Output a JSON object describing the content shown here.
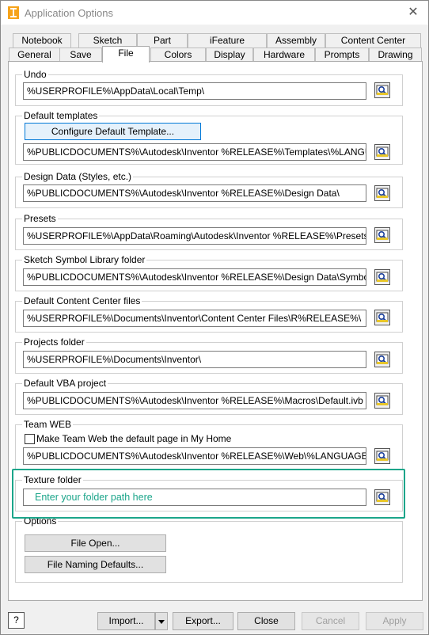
{
  "window": {
    "title": "Application Options",
    "close_glyph": "✕"
  },
  "tabs_row_top": [
    "Notebook",
    "Sketch",
    "Part",
    "iFeature",
    "Assembly",
    "Content Center"
  ],
  "tabs_row_bottom": [
    "General",
    "Save",
    "File",
    "Colors",
    "Display",
    "Hardware",
    "Prompts",
    "Drawing"
  ],
  "active_tab": "File",
  "groups": {
    "undo": {
      "label": "Undo",
      "path": "%USERPROFILE%\\AppData\\Local\\Temp\\"
    },
    "default_templates": {
      "label": "Default templates",
      "configure_button": "Configure Default Template...",
      "path": "%PUBLICDOCUMENTS%\\Autodesk\\Inventor %RELEASE%\\Templates\\%LANGUAGE%\\"
    },
    "design_data": {
      "label": "Design Data (Styles, etc.)",
      "path": "%PUBLICDOCUMENTS%\\Autodesk\\Inventor %RELEASE%\\Design Data\\"
    },
    "presets": {
      "label": "Presets",
      "path": "%USERPROFILE%\\AppData\\Roaming\\Autodesk\\Inventor %RELEASE%\\Presets\\"
    },
    "sketch_symbol": {
      "label": "Sketch Symbol Library folder",
      "path": "%PUBLICDOCUMENTS%\\Autodesk\\Inventor %RELEASE%\\Design Data\\Symbol Library\\"
    },
    "content_center": {
      "label": "Default Content Center files",
      "path": "%USERPROFILE%\\Documents\\Inventor\\Content Center Files\\R%RELEASE%\\"
    },
    "projects": {
      "label": "Projects folder",
      "path": "%USERPROFILE%\\Documents\\Inventor\\"
    },
    "vba": {
      "label": "Default VBA project",
      "path": "%PUBLICDOCUMENTS%\\Autodesk\\Inventor %RELEASE%\\Macros\\Default.ivb"
    },
    "team_web": {
      "label": "Team WEB",
      "checkbox_label": "Make Team Web the default page in My Home",
      "path": "%PUBLICDOCUMENTS%\\Autodesk\\Inventor %RELEASE%\\Web\\%LANGUAGE%\\Custom"
    },
    "texture": {
      "label": "Texture folder",
      "placeholder": "Enter your folder path here"
    },
    "options": {
      "label": "Options",
      "file_open_button": "File Open...",
      "file_naming_button": "File Naming Defaults..."
    }
  },
  "footer": {
    "help": "?",
    "import": "Import...",
    "export": "Export...",
    "close": "Close",
    "cancel": "Cancel",
    "apply": "Apply"
  },
  "colors": {
    "highlight": "#1ba58a",
    "focus_border": "#0078d7"
  },
  "icons": {
    "app": "inventor-app-icon",
    "browse": "browse-folder-icon",
    "close": "close-icon",
    "help": "help-icon",
    "dropdown": "dropdown-arrow-icon"
  }
}
